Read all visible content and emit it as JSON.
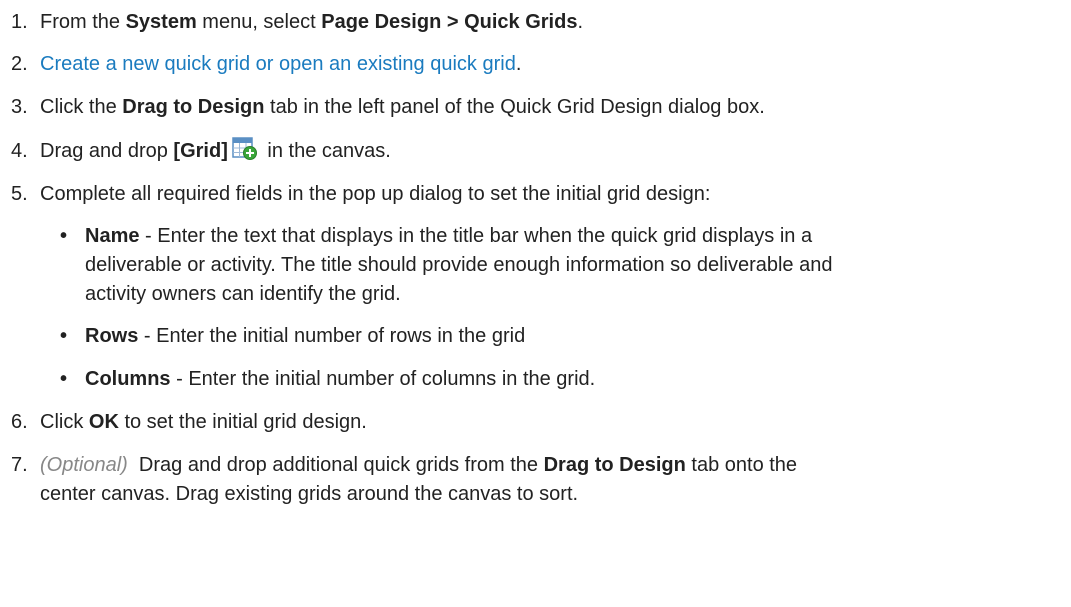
{
  "steps": [
    {
      "num": "1.",
      "pre": "From the ",
      "b1": "System",
      "mid": " menu, select ",
      "b2": "Page Design > Quick Grids",
      "post": "."
    },
    {
      "num": "2.",
      "link": "Create a new quick grid or open an existing quick grid",
      "post": "."
    },
    {
      "num": "3.",
      "pre": "Click the ",
      "b1": "Drag to Design",
      "post": " tab in the left panel of the Quick Grid Design dialog box."
    },
    {
      "num": "4.",
      "pre": "Drag and drop ",
      "b1": "[Grid]",
      "icon": "grid-add-icon",
      "post": " in the canvas."
    },
    {
      "num": "5.",
      "text": "Complete all required fields in the pop up dialog to set the initial grid design:"
    },
    {
      "num": "6.",
      "pre": "Click ",
      "b1": "OK",
      "post": " to set the initial grid design."
    },
    {
      "num": "7.",
      "opt": "(Optional)",
      "pre": "  Drag and drop additional quick grids from the ",
      "b1": "Drag to Design",
      "post1": " tab onto the",
      "line2": "center canvas. Drag existing grids around the canvas to sort."
    }
  ],
  "fields": [
    {
      "bullet": "•",
      "label": "Name",
      "line1": " - Enter the text that displays in the title bar when the quick grid displays in a",
      "line2": "deliverable or activity. The title should provide enough information so deliverable and",
      "line3": "activity owners can identify the grid."
    },
    {
      "bullet": "•",
      "label": "Rows",
      "line1": " - Enter the initial number of rows in the grid"
    },
    {
      "bullet": "•",
      "label": "Columns",
      "line1": " - Enter the initial number of columns in the grid."
    }
  ],
  "colors": {
    "text": "#222222",
    "link": "#1a7bbf",
    "optional": "#888888",
    "icon_green": "#3aa63a",
    "icon_blue": "#5a8fc4"
  }
}
